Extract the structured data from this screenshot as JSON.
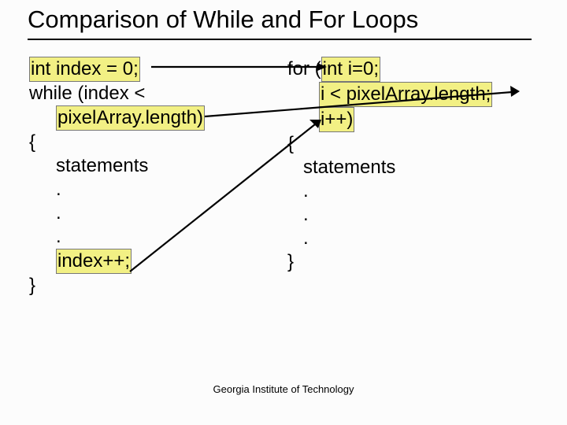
{
  "title": "Comparison of While and For Loops",
  "footer": "Georgia Institute of Technology",
  "while": {
    "l1": "int index = 0;",
    "l2": "while (index <",
    "l3": "pixelArray.length)",
    "l4": "{",
    "l5": "statements",
    "dot": ".",
    "l9": "index++;",
    "l10": "}"
  },
  "for": {
    "l1_a": "for (",
    "l1_b": "int i=0;",
    "l2": "i < pixelArray.length;",
    "l3": "i++)",
    "l4": "{",
    "l5": "statements",
    "dot": ".",
    "l9": "}"
  }
}
